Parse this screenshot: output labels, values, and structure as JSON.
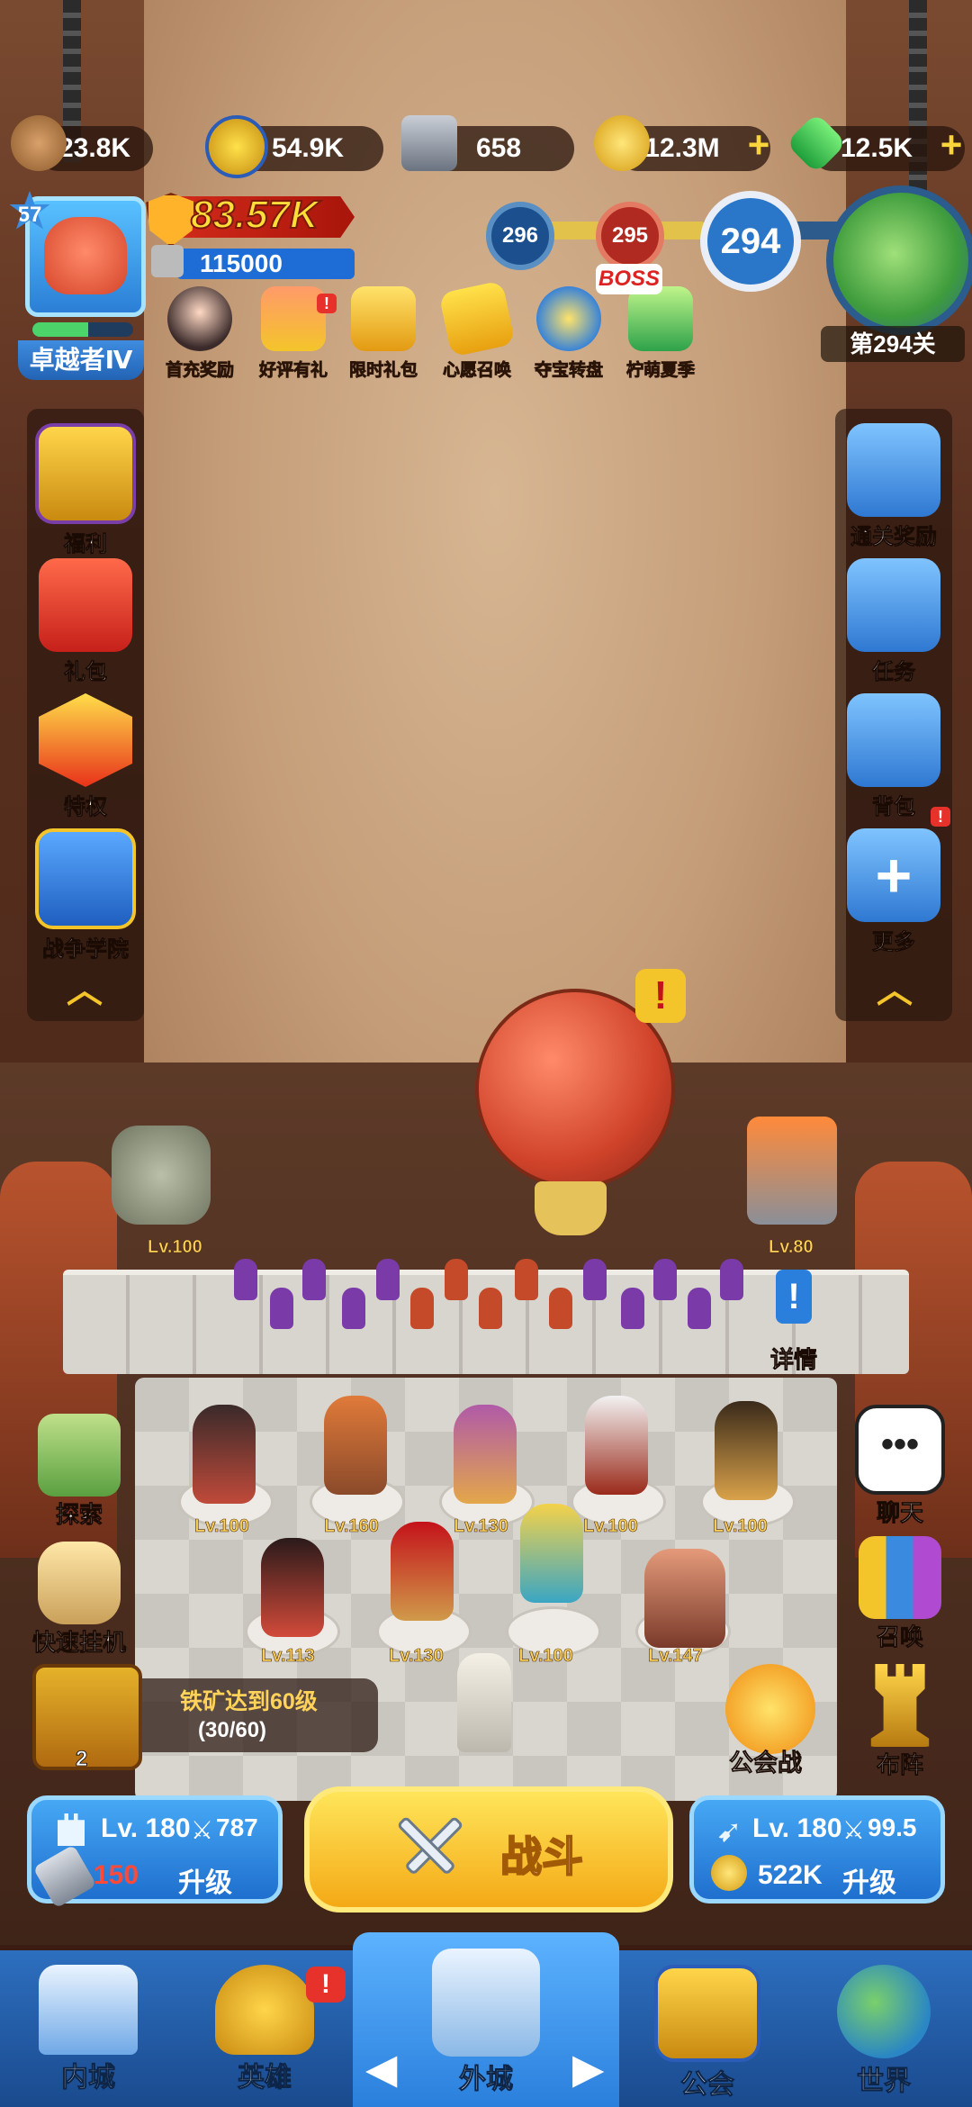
{
  "resources": {
    "wood": "23.8K",
    "star_coin": "54.9K",
    "iron": "658",
    "gold": "12.3M",
    "gem": "12.5K"
  },
  "player": {
    "level": "57",
    "rank_title": "卓越者Ⅳ",
    "power": "83.57K",
    "castle_power": "115000",
    "rank_progress_fraction": 0.55
  },
  "events": [
    {
      "label": "首充奖励",
      "icon": "girl-avatar-icon"
    },
    {
      "label": "好评有礼",
      "icon": "star-card-icon"
    },
    {
      "label": "限时礼包",
      "icon": "crown-gift-icon"
    },
    {
      "label": "心愿召唤",
      "icon": "ticket-icon"
    },
    {
      "label": "夺宝转盘",
      "icon": "wheel-icon"
    },
    {
      "label": "柠萌夏季",
      "icon": "lemon-drink-icon"
    }
  ],
  "stage": {
    "node_prev": "296",
    "node_boss": "295",
    "boss_tag": "BOSS",
    "current": "294",
    "map_label": "第294关"
  },
  "left_menu": [
    {
      "label": "福利",
      "icon": "crown-shield-icon"
    },
    {
      "label": "礼包",
      "icon": "gift-icon"
    },
    {
      "label": "特权",
      "icon": "crown-badge-icon"
    },
    {
      "label": "战争学院",
      "icon": "crossed-swords-icon"
    }
  ],
  "right_menu": [
    {
      "label": "通关奖励",
      "icon": "gift-box-icon"
    },
    {
      "label": "任务",
      "icon": "task-scroll-icon"
    },
    {
      "label": "背包",
      "icon": "backpack-icon"
    },
    {
      "label": "更多",
      "icon": "plus-icon"
    }
  ],
  "battlefield": {
    "left_statue_level": "Lv.100",
    "right_tower_level": "Lv.80",
    "details_label": "详情"
  },
  "heroes": {
    "row1": [
      "Lv.100",
      "Lv.160",
      "Lv.130",
      "Lv.100",
      "Lv.100"
    ],
    "row2": [
      "Lv.113",
      "Lv.130",
      "Lv.100",
      "Lv.147"
    ]
  },
  "courtyard_left": [
    {
      "label": "探索",
      "icon": "map-icon"
    },
    {
      "label": "快速挂机",
      "icon": "hourglass-icon"
    }
  ],
  "courtyard_right": [
    {
      "label": "聊天",
      "icon": "chat-icon"
    },
    {
      "label": "召唤",
      "icon": "cards-icon"
    },
    {
      "label": "布阵",
      "icon": "chess-rook-icon"
    }
  ],
  "guild_war_label": "公会战",
  "quest": {
    "title": "铁矿达到60级",
    "progress": "(30/60)",
    "chest_count": "2"
  },
  "upgrade_left": {
    "level": "Lv. 180",
    "attack": "787",
    "cost": "150",
    "button": "升级"
  },
  "fight_label": "战斗",
  "upgrade_right": {
    "level": "Lv. 180",
    "attack": "99.5",
    "cost": "522K",
    "button": "升级"
  },
  "nav": [
    {
      "label": "内城",
      "icon": "castle-icon"
    },
    {
      "label": "英雄",
      "icon": "helmet-icon"
    },
    {
      "label": "外城",
      "icon": "tower-icon"
    },
    {
      "label": "公会",
      "icon": "handshake-icon"
    },
    {
      "label": "世界",
      "icon": "globe-icon"
    }
  ],
  "colors": {
    "accent_blue": "#2a7fdc",
    "gold": "#ffd35a",
    "alert_red": "#e6322a",
    "fight_yellow": "#f4a916"
  }
}
